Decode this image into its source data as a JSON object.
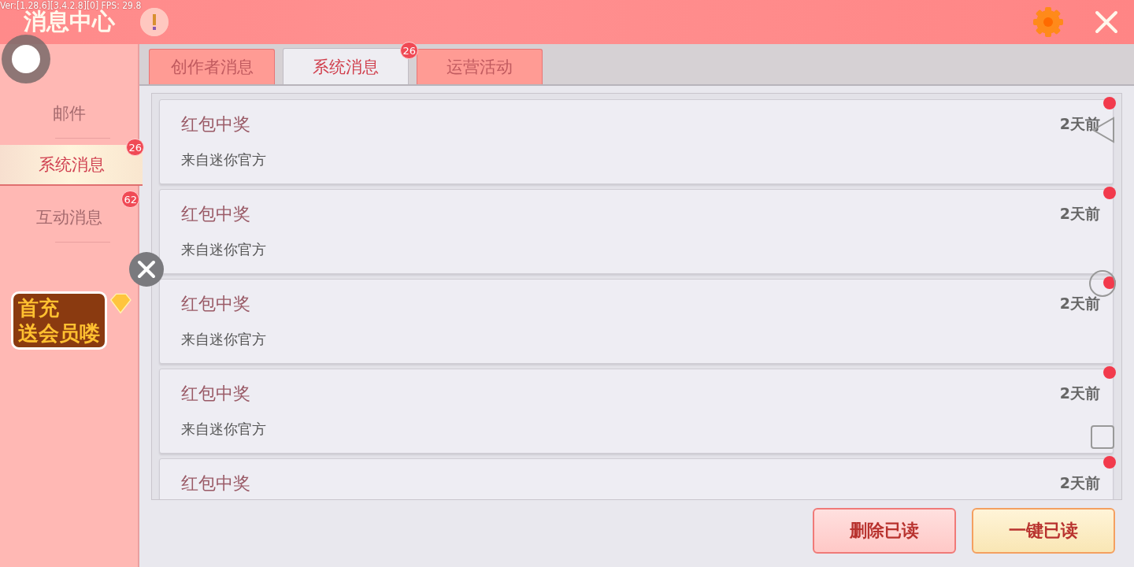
{
  "debug_overlay": "Ver:[1.28.6][3.4.2.8][0] FPS: 29.8",
  "window": {
    "title": "消息中心"
  },
  "sidebar": {
    "items": [
      {
        "label": "邮件",
        "selected": false
      },
      {
        "label": "系统消息",
        "selected": true,
        "badge": "26"
      },
      {
        "label": "互动消息",
        "selected": false,
        "badge": "62"
      }
    ],
    "promo": {
      "line_1": "首充",
      "line_2": "送会员喽"
    }
  },
  "tabs": [
    {
      "label": "创作者消息",
      "selected": false
    },
    {
      "label": "系统消息",
      "selected": true,
      "badge": "26"
    },
    {
      "label": "运营活动",
      "selected": false
    }
  ],
  "messages": [
    {
      "title": "红包中奖",
      "source": "来自迷你官方",
      "time": "2天前",
      "unread": true
    },
    {
      "title": "红包中奖",
      "source": "来自迷你官方",
      "time": "2天前",
      "unread": true
    },
    {
      "title": "红包中奖",
      "source": "来自迷你官方",
      "time": "2天前",
      "unread": true
    },
    {
      "title": "红包中奖",
      "source": "来自迷你官方",
      "time": "2天前",
      "unread": true
    },
    {
      "title": "红包中奖",
      "time": "2天前",
      "unread": true
    }
  ],
  "buttons": [
    {
      "label": "删除已读",
      "kind": "secondary"
    },
    {
      "label": "一键已读",
      "kind": "primary"
    }
  ]
}
